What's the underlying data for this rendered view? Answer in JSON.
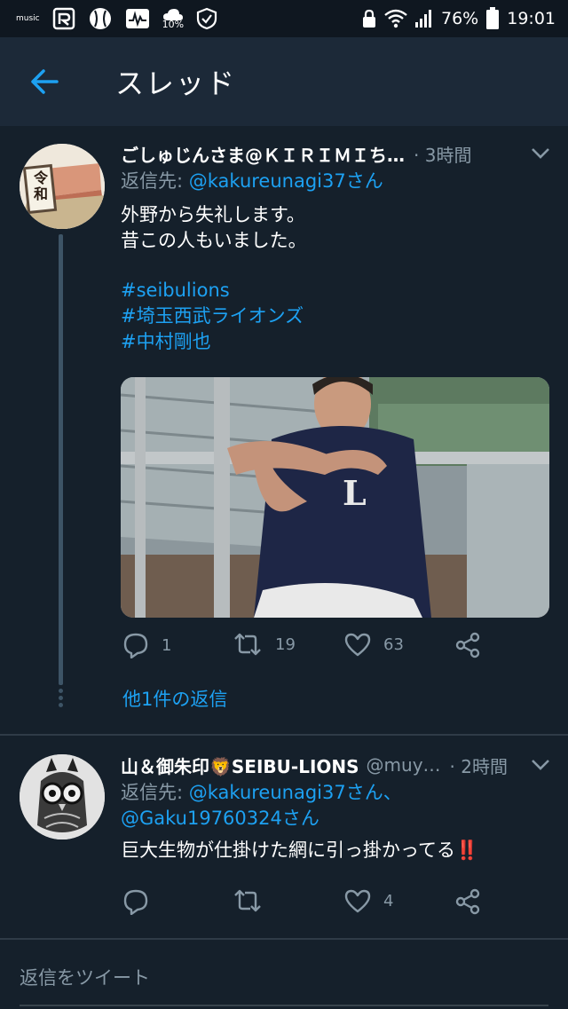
{
  "status_bar": {
    "left_icons": [
      "amazon-music-icon",
      "r-app-icon",
      "baseball-icon",
      "stocks-icon",
      "weather-rain-icon",
      "shield-check-icon"
    ],
    "music_label": "music",
    "rain_percent": "10%",
    "battery_percent": "76%",
    "time": "19:01"
  },
  "app_bar": {
    "title": "スレッド"
  },
  "tweet1": {
    "name": "ごしゅじんさま@ＫＩＲＩＭＩち…",
    "time": "· 3時間",
    "reply_to_label": "返信先:",
    "reply_to_user": "@kakureunagi37さん",
    "text_lines": [
      "外野から失礼します。",
      "昔この人もいました。"
    ],
    "hashtags": [
      "#seibulions",
      "#埼玉西武ライオンズ",
      "#中村剛也"
    ],
    "avatar_text": "令和",
    "jersey_letter": "L",
    "replies": "1",
    "retweets": "19",
    "likes": "63",
    "more_replies": "他1件の返信"
  },
  "tweet2": {
    "name": "山＆御朱印🦁SEIBU-LIONS",
    "handle": "@muy…",
    "time": "· 2時間",
    "reply_to_label": "返信先:",
    "reply_to_users": "@kakureunagi37さん、",
    "reply_to_users2": "@Gaku19760324さん",
    "text": "巨大生物が仕掛けた網に引っ掛かってる‼️",
    "replies": "",
    "retweets": "",
    "likes": "4"
  },
  "reply_bar": {
    "placeholder": "返信をツイート"
  },
  "colors": {
    "background": "#15202b",
    "app_bar": "#1c2938",
    "accent": "#1da1f2",
    "secondary_text": "#8899a6"
  }
}
